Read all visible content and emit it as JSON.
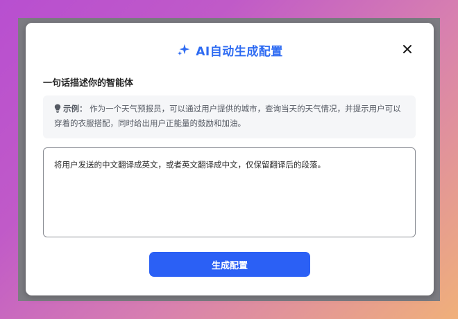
{
  "dialog": {
    "title": "AI自动生成配置",
    "section_label": "一句话描述你的智能体",
    "example": {
      "prefix": "示例：",
      "text": "作为一个天气预报员，可以通过用户提供的城市，查询当天的天气情况，并提示用户可以穿着的衣服搭配，同时给出用户正能量的鼓励和加油。"
    },
    "input_value": "将用户发送的中文翻译成英文，或者英文翻译成中文，仅保留翻译后的段落。",
    "generate_label": "生成配置"
  },
  "icons": {
    "title_icon": "sparkle-icon",
    "close": "close-icon",
    "example_icon": "lightbulb-icon"
  },
  "colors": {
    "accent": "#2b60f5",
    "title": "#2e6bf2"
  }
}
